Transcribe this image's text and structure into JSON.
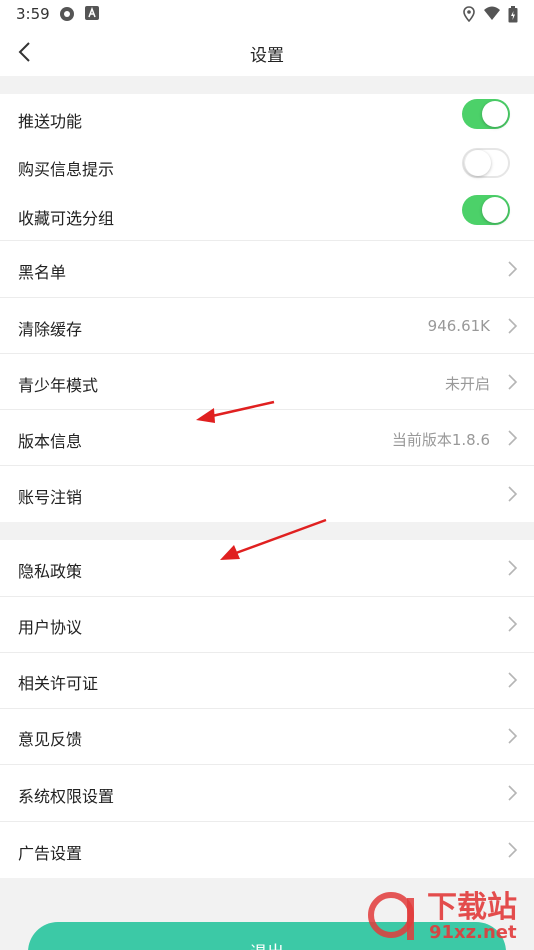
{
  "status_bar": {
    "time": "3:59"
  },
  "header": {
    "title": "设置"
  },
  "toggles": [
    {
      "label": "推送功能",
      "on": true
    },
    {
      "label": "购买信息提示",
      "on": false
    },
    {
      "label": "收藏可选分组",
      "on": true
    }
  ],
  "settings": [
    {
      "label": "黑名单",
      "value": ""
    },
    {
      "label": "清除缓存",
      "value": "946.61K"
    },
    {
      "label": "青少年模式",
      "value": "未开启"
    },
    {
      "label": "版本信息",
      "value": "当前版本1.8.6"
    },
    {
      "label": "账号注销",
      "value": ""
    }
  ],
  "info": [
    {
      "label": "隐私政策"
    },
    {
      "label": "用户协议"
    },
    {
      "label": "相关许可证"
    },
    {
      "label": "意见反馈"
    },
    {
      "label": "系统权限设置"
    },
    {
      "label": "广告设置"
    }
  ],
  "logout_label": "退出",
  "watermark": {
    "brand": "下载站",
    "domain": "91xz.net"
  },
  "colors": {
    "accent": "#3cc9a6",
    "toggle_on": "#4cd169",
    "arrow": "#e02020"
  }
}
